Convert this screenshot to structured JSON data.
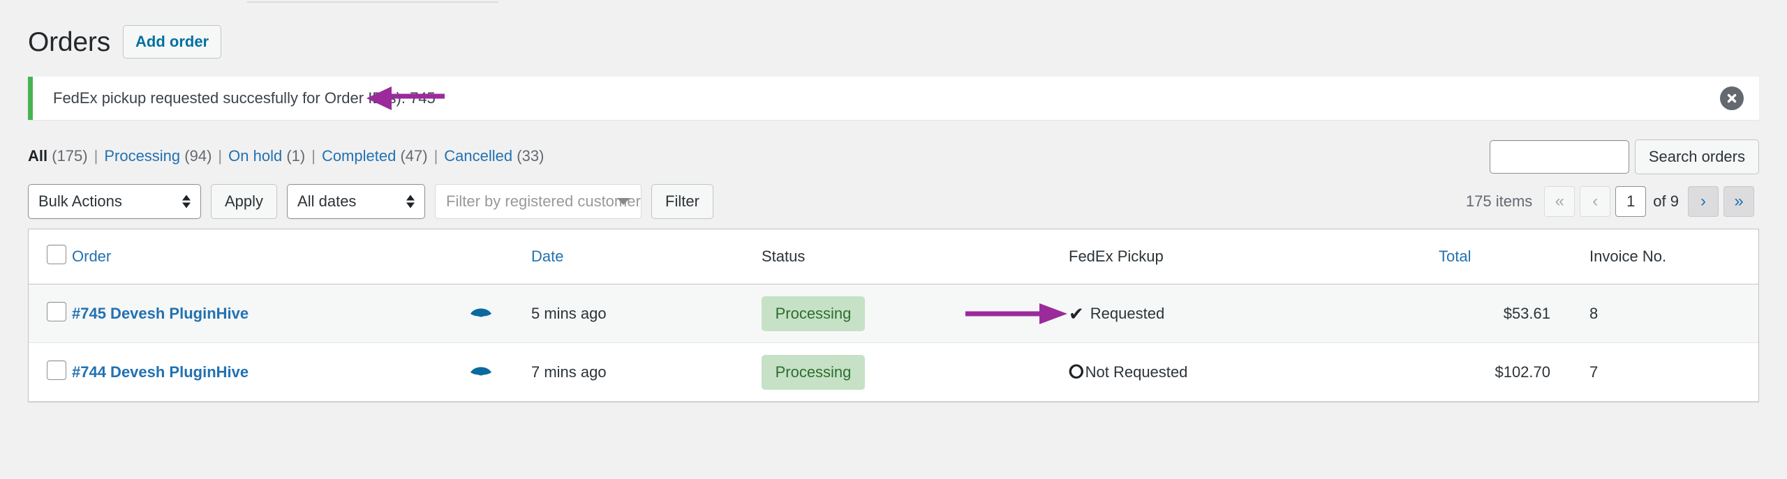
{
  "header": {
    "title": "Orders",
    "add_order_label": "Add order"
  },
  "notice": {
    "message": "FedEx pickup requested succesfully for Order ID(s): 745",
    "accent_color": "#46b450",
    "dismiss_label": "Dismiss this notice"
  },
  "annotations": {
    "color": "#9b2a9b",
    "arrow_notice": "points-left-at-order-id",
    "arrow_pickup": "points-right-at-requested"
  },
  "status_links": [
    {
      "label": "All",
      "count": "(175)",
      "current": true
    },
    {
      "label": "Processing",
      "count": "(94)",
      "current": false
    },
    {
      "label": "On hold",
      "count": "(1)",
      "current": false
    },
    {
      "label": "Completed",
      "count": "(47)",
      "current": false
    },
    {
      "label": "Cancelled",
      "count": "(33)",
      "current": false
    }
  ],
  "search": {
    "value": "",
    "placeholder": "",
    "button_label": "Search orders"
  },
  "toolbar": {
    "bulk_actions_value": "Bulk Actions",
    "apply_label": "Apply",
    "date_filter_value": "All dates",
    "customer_filter_placeholder": "Filter by registered customer",
    "filter_label": "Filter"
  },
  "pagination": {
    "items_text": "175 items",
    "first_label": "«",
    "prev_label": "‹",
    "current_page": "1",
    "total_pages_text": "of 9",
    "next_label": "›",
    "last_label": "»"
  },
  "table": {
    "columns": [
      {
        "key": "cb",
        "label": "",
        "sortable": false
      },
      {
        "key": "order",
        "label": "Order",
        "sortable": true
      },
      {
        "key": "preview",
        "label": "",
        "sortable": false
      },
      {
        "key": "date",
        "label": "Date",
        "sortable": true
      },
      {
        "key": "status",
        "label": "Status",
        "sortable": false
      },
      {
        "key": "fedex",
        "label": "FedEx Pickup",
        "sortable": false
      },
      {
        "key": "total",
        "label": "Total",
        "sortable": true
      },
      {
        "key": "invoice",
        "label": "Invoice No.",
        "sortable": false
      }
    ],
    "rows": [
      {
        "order": "#745 Devesh PluginHive",
        "preview_icon": "eye-icon",
        "date": "5 mins ago",
        "status": "Processing",
        "pickup_mark": "✔",
        "pickup_text": "Requested",
        "total": "$53.61",
        "invoice": "8"
      },
      {
        "order": "#744 Devesh PluginHive",
        "preview_icon": "eye-icon",
        "date": "7 mins ago",
        "status": "Processing",
        "pickup_mark": "⭘",
        "pickup_text": "Not Requested",
        "total": "$102.70",
        "invoice": "7"
      }
    ]
  }
}
